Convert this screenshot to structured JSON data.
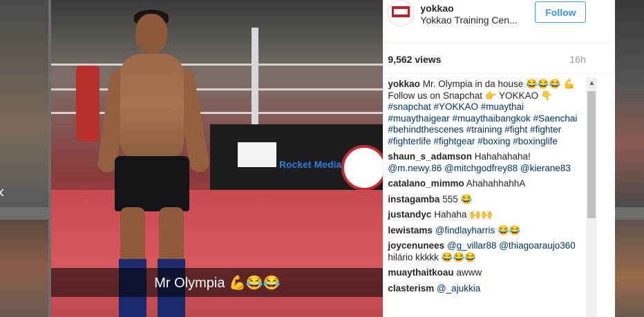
{
  "post": {
    "username": "yokkao",
    "subtitle": "Yokkao Training Cen...",
    "follow_label": "Follow",
    "views": "9,562 views",
    "time": "16h"
  },
  "media": {
    "caption": "Mr Olympia 💪😂😂",
    "brand_text": "Rocket Media"
  },
  "comments": [
    {
      "user": "yokkao",
      "text": "Mr. Olympia in da house 😂😂😂 💪 Follow us on Snapchat 👉 YOKKAO 👇",
      "links": "#snapchat #YOKKAO #muaythai #muaythaigear #muaythaibangkok #Saenchai #behindthescenes #training #fight #fighter #fighterlife #fightgear #boxing #boxinglife"
    },
    {
      "user": "shaun_s_adamson",
      "text": "Hahahahaha!",
      "links": "@m.newy.86 @mitchgodfrey88 @kierane83"
    },
    {
      "user": "catalano_mimmo",
      "text": "AhahahhahhA",
      "links": ""
    },
    {
      "user": "instagamba",
      "text": "555 😂",
      "links": ""
    },
    {
      "user": "justandyc",
      "text": "Hahaha 🙌🙌",
      "links": ""
    },
    {
      "user": "lewistams",
      "text": "😂😂",
      "links": "@findlayharris"
    },
    {
      "user": "joycenunees",
      "text": "hilário kkkkk 😂😂😂",
      "links": "@g_villar88 @thiagoaraujo360"
    },
    {
      "user": "muaythaitkoau",
      "text": "awww",
      "links": ""
    },
    {
      "user": "clasterism",
      "text": "",
      "links": "@_ajukkia"
    }
  ],
  "icons": {
    "prev": "chevron-left-icon",
    "scroll_up": "triangle-up-icon"
  },
  "colors": {
    "link": "#003569",
    "follow": "#3897f0"
  }
}
